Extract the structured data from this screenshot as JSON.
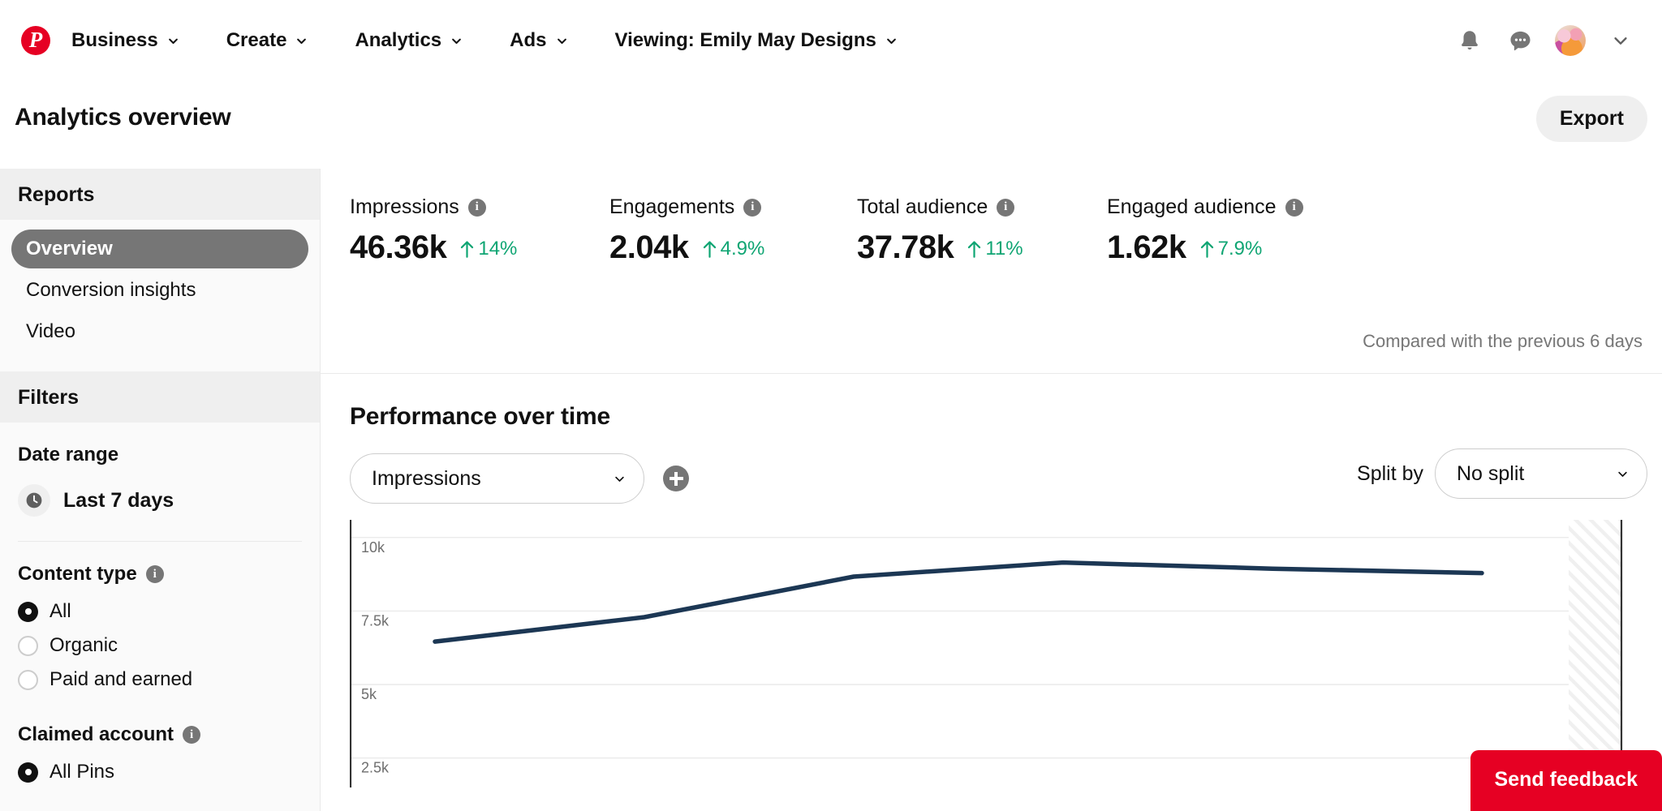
{
  "nav": {
    "logo_icon": "pinterest-logo-icon",
    "items": [
      {
        "label": "Business",
        "icon": "chevron-down-icon"
      },
      {
        "label": "Create",
        "icon": "chevron-down-icon"
      },
      {
        "label": "Analytics",
        "icon": "chevron-down-icon"
      },
      {
        "label": "Ads",
        "icon": "chevron-down-icon"
      },
      {
        "label": "Viewing: Emily May Designs",
        "icon": "chevron-down-icon"
      }
    ],
    "right_icons": [
      {
        "name": "notifications-bell-icon"
      },
      {
        "name": "messages-bubble-icon"
      },
      {
        "name": "user-avatar"
      },
      {
        "name": "chevron-down-icon"
      }
    ]
  },
  "header": {
    "title": "Analytics overview",
    "export_label": "Export"
  },
  "sidebar": {
    "reports_heading": "Reports",
    "reports": [
      {
        "label": "Overview",
        "active": true
      },
      {
        "label": "Conversion insights",
        "active": false
      },
      {
        "label": "Video",
        "active": false
      }
    ],
    "filters_heading": "Filters",
    "date_range": {
      "label": "Date range",
      "icon": "clock-icon",
      "value": "Last 7 days"
    },
    "content_type": {
      "label": "Content type",
      "info_icon": "info-icon",
      "options": [
        {
          "label": "All",
          "selected": true
        },
        {
          "label": "Organic",
          "selected": false
        },
        {
          "label": "Paid and earned",
          "selected": false
        }
      ]
    },
    "claimed_account": {
      "label": "Claimed account",
      "info_icon": "info-icon",
      "options": [
        {
          "label": "All Pins",
          "selected": true
        }
      ]
    }
  },
  "metrics": {
    "items": [
      {
        "name": "Impressions",
        "value": "46.36k",
        "delta": "14%",
        "direction": "up",
        "info_icon": "info-icon"
      },
      {
        "name": "Engagements",
        "value": "2.04k",
        "delta": "4.9%",
        "direction": "up",
        "info_icon": "info-icon"
      },
      {
        "name": "Total audience",
        "value": "37.78k",
        "delta": "11%",
        "direction": "up",
        "info_icon": "info-icon"
      },
      {
        "name": "Engaged audience",
        "value": "1.62k",
        "delta": "7.9%",
        "direction": "up",
        "info_icon": "info-icon"
      }
    ],
    "compared_text": "Compared with the previous 6 days",
    "up_color": "#0fa573"
  },
  "performance": {
    "title": "Performance over time",
    "metric_select": {
      "value": "Impressions",
      "icon": "chevron-down-icon"
    },
    "add_metric": {
      "name": "add-metric-icon"
    },
    "split_by": {
      "label": "Split by",
      "value": "No split",
      "icon": "chevron-down-icon"
    }
  },
  "feedback": {
    "label": "Send feedback"
  },
  "colors": {
    "brand_red": "#e60023",
    "line_navy": "#1c3754",
    "accent_green": "#0fa573",
    "active_gray": "#767676"
  },
  "chart_data": {
    "type": "line",
    "title": "Performance over time",
    "series": [
      {
        "name": "Impressions",
        "color": "#1c3754",
        "values": [
          6460,
          7290,
          8670,
          9150,
          8940,
          8790
        ]
      }
    ],
    "x": [
      0,
      1,
      2,
      3,
      4,
      5
    ],
    "xlabel": "",
    "ylabel": "",
    "ylim": [
      1500,
      10600
    ],
    "yticks": [
      10000,
      7500,
      5000,
      2500
    ],
    "ytick_labels": [
      "10k",
      "7.5k",
      "5k",
      "2.5k"
    ],
    "grid": true,
    "legend": false,
    "partial_data_band": true
  }
}
